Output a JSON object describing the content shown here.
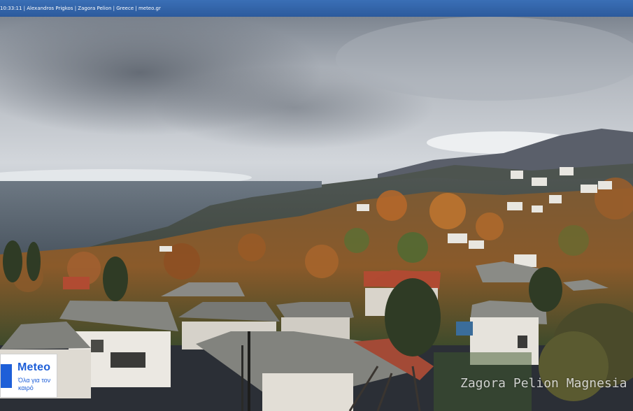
{
  "overlay": {
    "time": "10:33:11",
    "photographer": "Alexandros Prigkos",
    "location": "Zagora Pelion",
    "country": "Greece",
    "site": "meteo.gr",
    "separator": " | "
  },
  "logo": {
    "name": "Meteo",
    "tagline": "Όλα για τον καιρό",
    "brand_color": "#1e5fd8"
  },
  "watermark": {
    "text": "Zagora Pelion Magnesia"
  },
  "colors": {
    "bar": "#3a6fb6",
    "sky": "#c8ccd2",
    "sea": "#5c6873",
    "foliage": "#b5662a"
  }
}
